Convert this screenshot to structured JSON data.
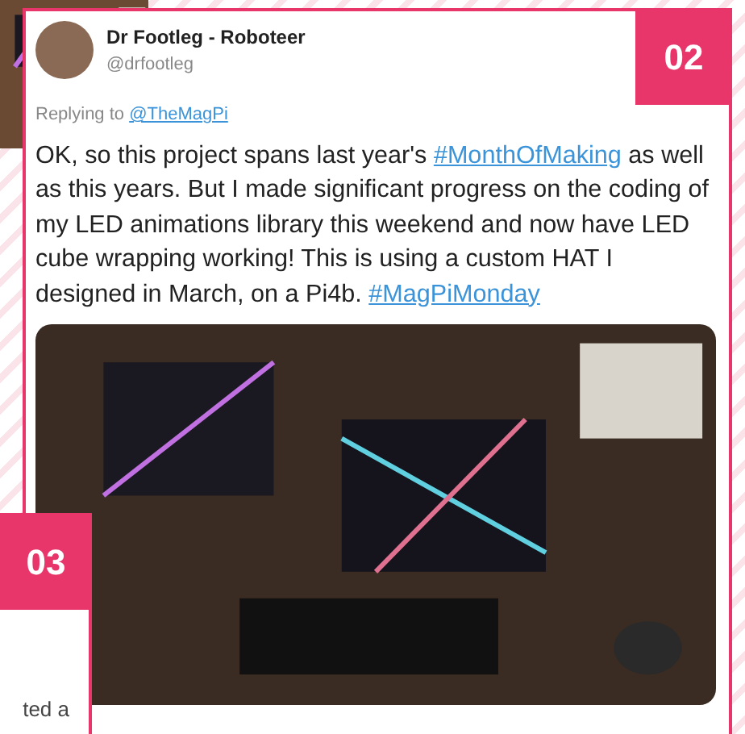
{
  "tweet": {
    "author_name": "Dr Footleg - Roboteer",
    "handle": "@drfootleg",
    "replying_label": "Replying to",
    "replying_to": "@TheMagPi",
    "body": [
      {
        "kind": "text",
        "text": "OK, so this project spans last year's "
      },
      {
        "kind": "hashtag",
        "text": "#MonthOfMaking"
      },
      {
        "kind": "text",
        "text": " as well as this years. But I made significant progress on the coding of my LED animations library this weekend and now have LED cube wrapping working! This is using a custom HAT I designed in March, on a Pi4b. "
      },
      {
        "kind": "hashtag",
        "text": "#MagPiMonday"
      }
    ]
  },
  "badges": [
    "02",
    "03"
  ],
  "side_text": "ted a"
}
